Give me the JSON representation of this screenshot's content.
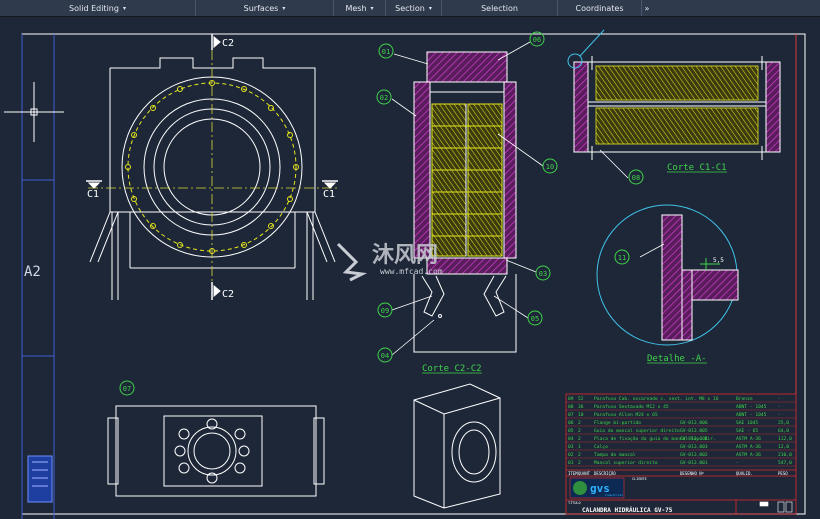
{
  "ribbon": {
    "tabs": [
      {
        "label": "Solid Editing",
        "dropdown": "▾"
      },
      {
        "label": "Surfaces",
        "dropdown": "▾"
      },
      {
        "label": "Mesh",
        "dropdown": "▾"
      },
      {
        "label": "Section",
        "dropdown": "▾"
      },
      {
        "label": "Selection",
        "dropdown": ""
      },
      {
        "label": "Coordinates",
        "dropdown": ""
      }
    ],
    "overflow": "»"
  },
  "drawing": {
    "sheet_size": "A2",
    "section_marks": {
      "c2_top": "C2",
      "c2_bottom": "C2",
      "c1_left": "C1",
      "c1_right": "C1"
    },
    "balloons": {
      "b01": "01",
      "b02": "02",
      "b03": "03",
      "b04": "04",
      "b05": "05",
      "b06": "06",
      "b07": "07",
      "b08": "08",
      "b09": "09",
      "b10": "10",
      "b11": "11"
    },
    "detail_dim": "5,5",
    "view_titles": {
      "corte_c1": "Corte C1-C1",
      "corte_c2": "Corte C2-C2",
      "detalhe": "Detalhe -A-"
    },
    "watermark": {
      "brand": "沐风网",
      "url": "www.mfcad.com"
    }
  },
  "bom": {
    "headers": [
      "ITEM",
      "QUANT",
      "DESCRIÇÃO",
      "DESENHO Nº",
      "QUALID.",
      "PESO"
    ],
    "rows": [
      [
        "09",
        "52",
        "Parafuso Cab. escareado c. sext. int. M8 x 16",
        "",
        "Bronze",
        "-"
      ],
      [
        "08",
        "36",
        "Parafuso Sextavado M12 x 45",
        "",
        "ABNT - 1045",
        "-"
      ],
      [
        "07",
        "10",
        "Parafuso Allen M24 x 65",
        "",
        "ABNT - 1045",
        "-"
      ],
      [
        "06",
        "2",
        "Flange bi-partido",
        "GV-013.006",
        "SAE 1045",
        "25,0"
      ],
      [
        "05",
        "2",
        "Guia do mancal superior direito",
        "GV-013.005",
        "SAE - 65",
        "64,0"
      ],
      [
        "04",
        "2",
        "Placa de fixação da guia do mancal Sup. Dir.",
        "GV-013.004",
        "ASTM A-36",
        "112,0"
      ],
      [
        "03",
        "1",
        "Calço",
        "GV-013.003",
        "ASTM A-36",
        "12,0"
      ],
      [
        "02",
        "2",
        "Tampa do mancal",
        "GV-013.002",
        "ASTM A-36",
        "210,0"
      ],
      [
        "01",
        "2",
        "Mancal superior direito",
        "GV-013.001",
        "-",
        "547,0"
      ]
    ],
    "client_label": "CLIENTE",
    "title_label": "TÍTULO",
    "drawing_title": "CALANDRA HIDRÁULICA GV-75",
    "logo_text": "gvs",
    "logo_sub": "industrial"
  },
  "colors": {
    "background": "#1e2738",
    "line": "#ffffff",
    "hatch_magenta": "#d23cd2",
    "roller_yellow": "#e6e61e",
    "balloon_green": "#3fd34a",
    "title_red": "#e02a2a",
    "centerline_yellow": "#d8d83a",
    "detail_cyan": "#3fc3e8"
  }
}
